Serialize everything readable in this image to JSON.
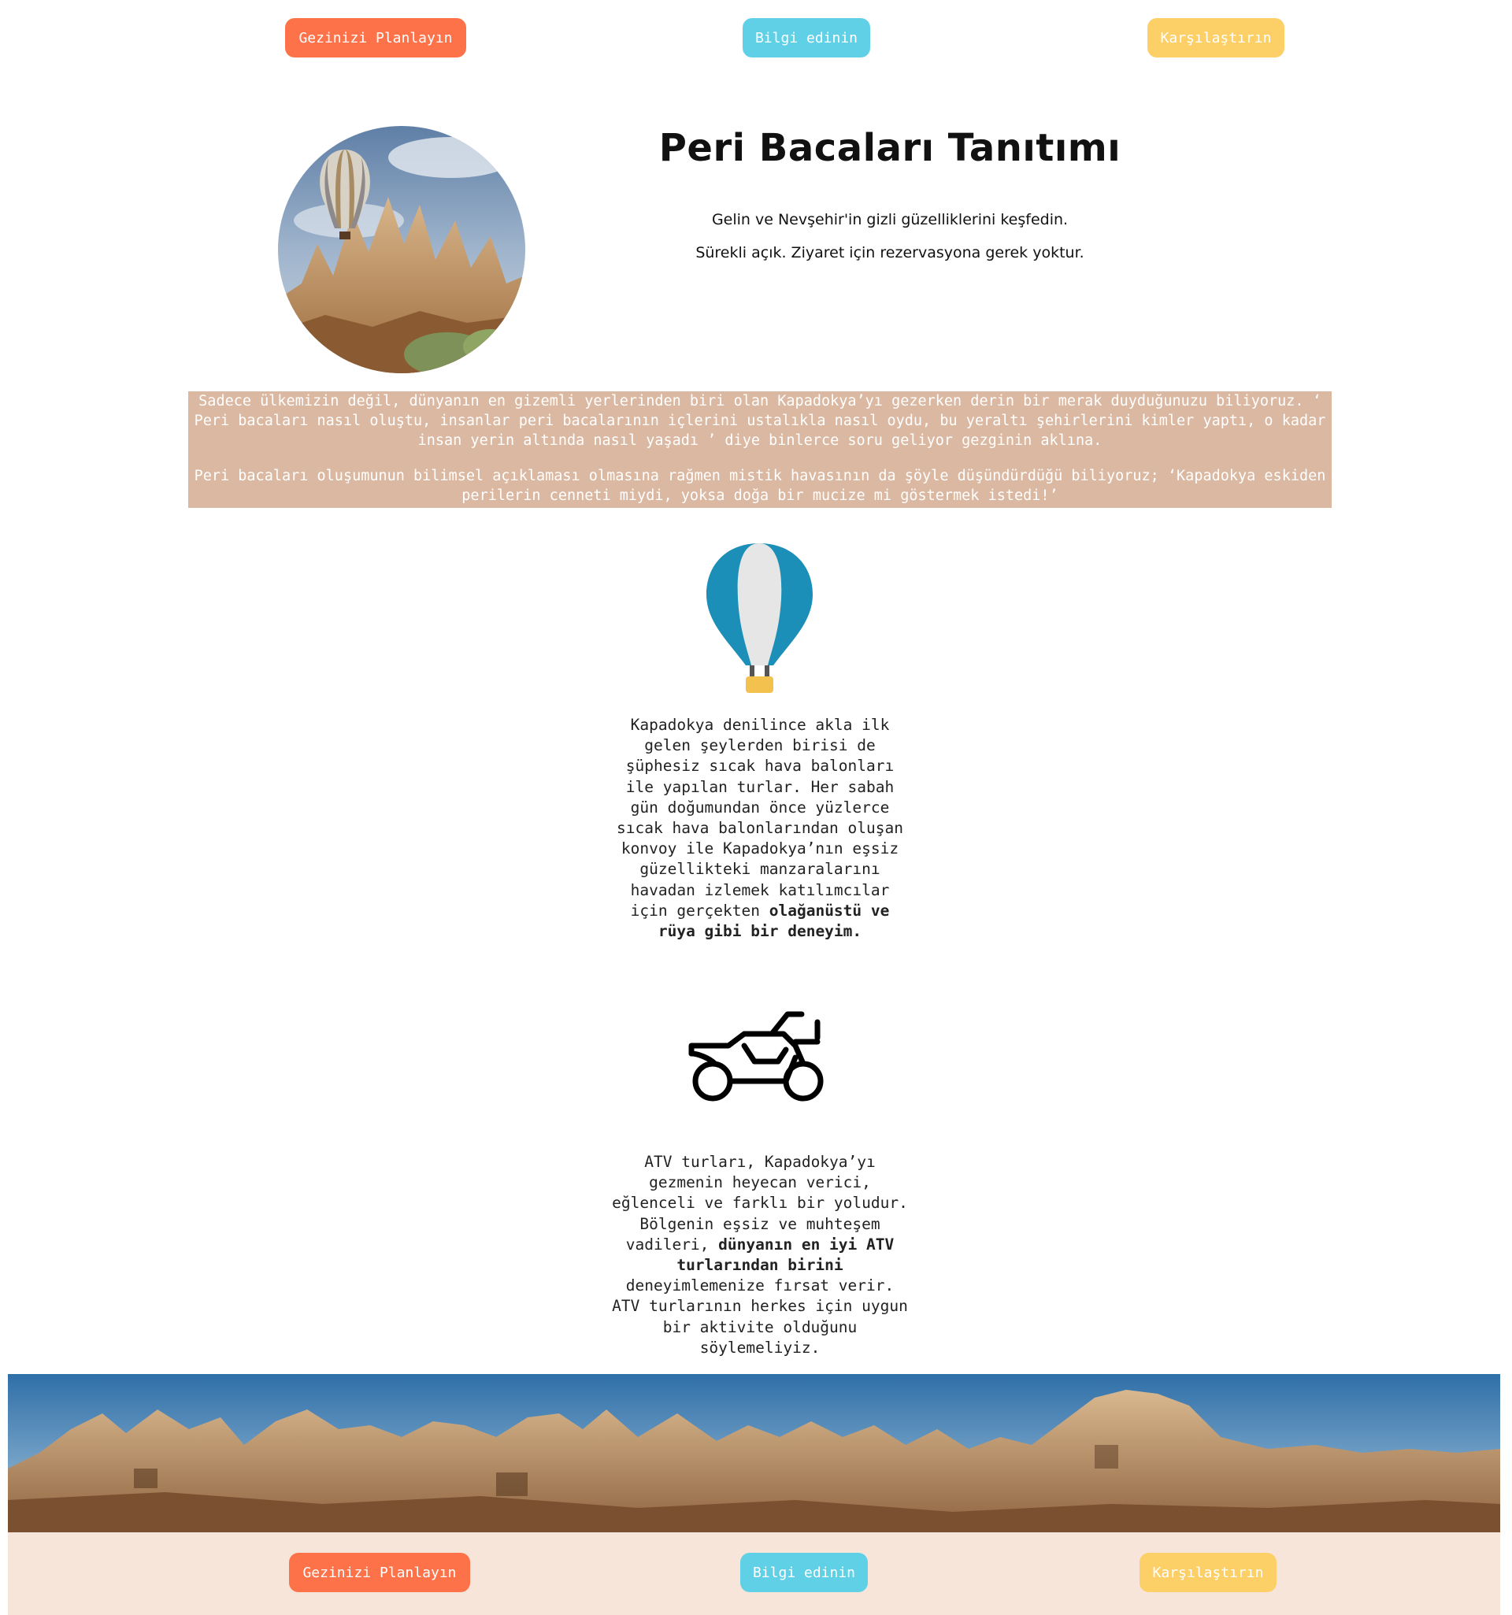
{
  "top_nav": {
    "plan_label": "Gezinizi Planlayın",
    "info_label": "Bilgi edinin",
    "compare_label": "Karşılaştırın"
  },
  "hero": {
    "title": "Peri Bacaları Tanıtımı",
    "subtitle_1": "Gelin ve Nevşehir'in gizli güzelliklerini keşfedin.",
    "subtitle_2": "Sürekli açık. Ziyaret için rezervasyona gerek yoktur."
  },
  "intro": {
    "paragraph_1": "Sadece ülkemizin değil, dünyanın en gizemli yerlerinden biri olan Kapadokya’yı gezerken derin bir merak duyduğunuzu biliyoruz. ‘ Peri bacaları nasıl oluştu, insanlar peri bacalarının içlerini ustalıkla nasıl oydu, bu yeraltı şehirlerini kimler yaptı, o kadar insan yerin altında nasıl yaşadı ’ diye binlerce soru geliyor gezginin aklına.",
    "paragraph_2": "Peri bacaları oluşumunun bilimsel açıklaması olmasına rağmen mistik havasının da şöyle düşündürdüğü biliyoruz; ‘Kapadokya eskiden perilerin cenneti miydi, yoksa doğa bir mucize mi göstermek istedi!’"
  },
  "balloon_feature": {
    "text": "Kapadokya denilince akla ilk gelen şeylerden birisi de şüphesiz sıcak hava balonları ile yapılan turlar. Her sabah gün doğumundan önce yüzlerce sıcak hava balonlarından oluşan konvoy ile Kapadokya’nın eşsiz güzellikteki manzaralarını havadan izlemek katılımcılar için gerçekten",
    "bold": "olağanüstü ve rüya gibi bir deneyim."
  },
  "atv_feature": {
    "text_before": "ATV turları, Kapadokya’yı gezmenin heyecan verici, eğlenceli ve farklı bir yoludur. Bölgenin eşsiz ve muhteşem vadileri,",
    "bold": "dünyanın en iyi ATV turlarından birini",
    "text_after": "deneyimlemenize fırsat verir. ATV turlarının herkes için uygun bir aktivite olduğunu söylemeliyiz."
  },
  "footer_nav": {
    "plan_label": "Gezinizi Planlayın",
    "info_label": "Bilgi edinin",
    "compare_label": "Karşılaştırın"
  },
  "colors": {
    "plan": "#fd7249",
    "info": "#5fd0e6",
    "compare": "#fdcf67",
    "intro_bg": "#dbb8a1",
    "footer_bg": "#f8e5da",
    "balloon_blue": "#1b8fb8"
  }
}
